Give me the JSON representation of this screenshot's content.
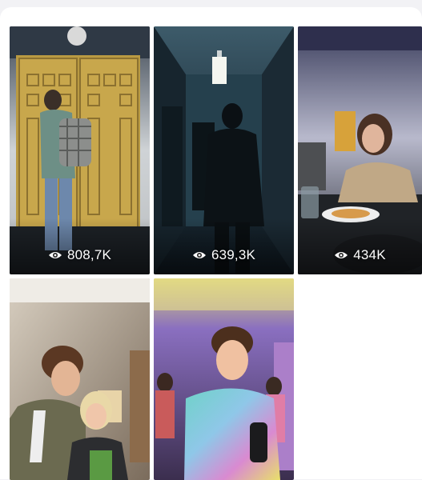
{
  "gallery": {
    "tiles": [
      {
        "id": "video-1",
        "views": "808,7K",
        "scene": "yellow-door-backpack"
      },
      {
        "id": "video-2",
        "views": "639,3K",
        "scene": "dark-hallway-silhouette"
      },
      {
        "id": "video-3",
        "views": "434K",
        "scene": "girl-at-dinner-table"
      },
      {
        "id": "video-4",
        "views": "",
        "scene": "boy-and-girl-room"
      },
      {
        "id": "video-5",
        "views": "",
        "scene": "curly-boy-tie-dye-party"
      }
    ],
    "icon": "eye-icon",
    "colors": {
      "view_text": "#ffffff",
      "background": "#ffffff"
    }
  }
}
